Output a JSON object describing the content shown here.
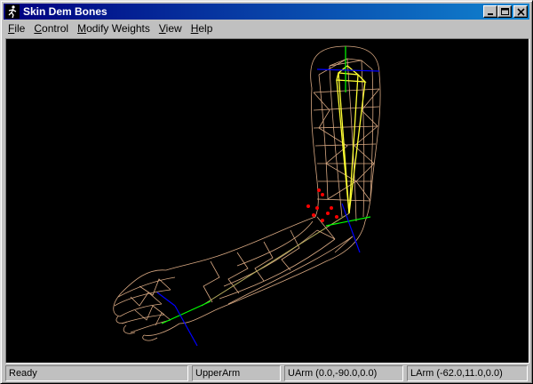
{
  "window": {
    "title": "Skin Dem Bones",
    "app_icon": "stick-figure-icon",
    "controls": [
      "minimize-icon",
      "maximize-icon",
      "close-icon"
    ]
  },
  "menu": [
    {
      "label": "File",
      "accel": "F",
      "rest": "ile"
    },
    {
      "label": "Control",
      "accel": "C",
      "rest": "ontrol"
    },
    {
      "label": "Modify Weights",
      "accel": "M",
      "rest": "odify Weights"
    },
    {
      "label": "View",
      "accel": "V",
      "rest": "iew"
    },
    {
      "label": "Help",
      "accel": "H",
      "rest": "elp"
    }
  ],
  "viewport": {
    "background": "#000000",
    "mesh_color": "#d8a882",
    "bone_color": "#ffff33",
    "axis_colors": {
      "x": "#0000ff",
      "y": "#00ff00",
      "selected": "#ff0000"
    }
  },
  "status": {
    "message": "Ready",
    "bone": "UpperArm",
    "uarm": "UArm (0.0,-90.0,0.0)",
    "larm": "LArm (-62.0,11.0,0.0)"
  }
}
